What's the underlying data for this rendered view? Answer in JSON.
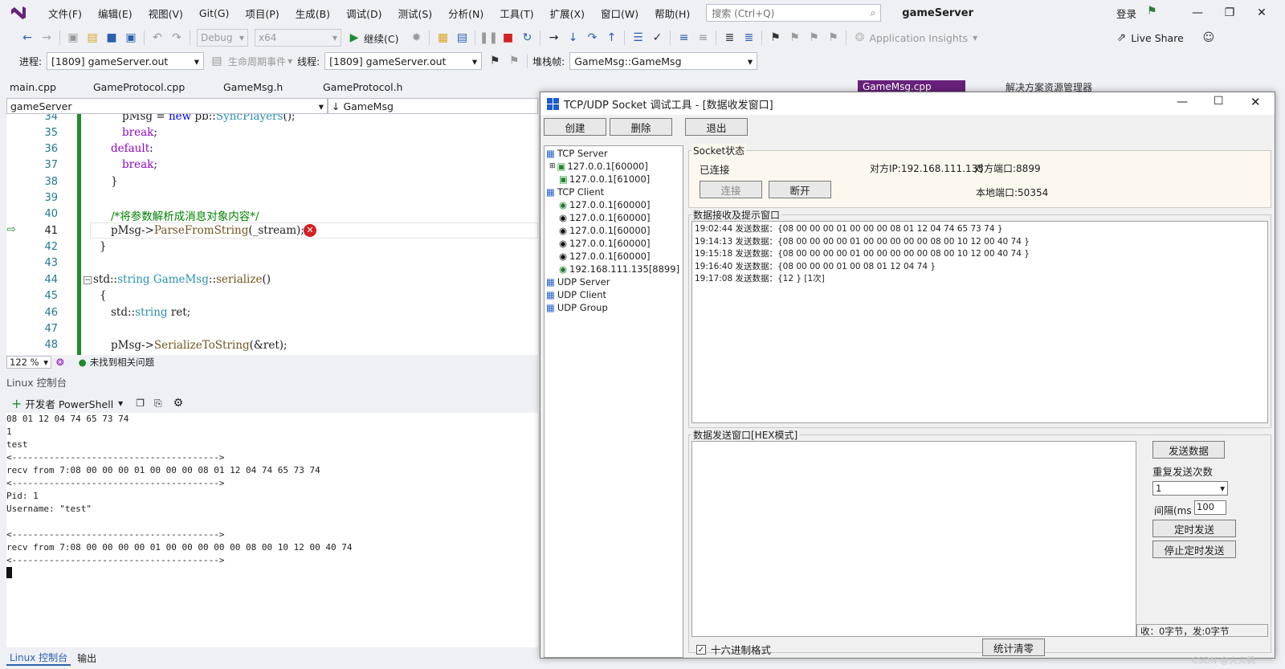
{
  "menus": [
    "文件(F)",
    "编辑(E)",
    "视图(V)",
    "Git(G)",
    "项目(P)",
    "生成(B)",
    "调试(D)",
    "测试(S)",
    "分析(N)",
    "工具(T)",
    "扩展(X)",
    "窗口(W)",
    "帮助(H)"
  ],
  "search_placeholder": "搜索 (Ctrl+Q)",
  "project_name": "gameServer",
  "login": "登录",
  "toolbar": {
    "config": "Debug",
    "platform": "x64",
    "continue": "继续(C)",
    "insights": "Application Insights",
    "live_share": "Live Share"
  },
  "debugbar": {
    "process_label": "进程:",
    "process": "[1809] gameServer.out",
    "lifecycle": "生命周期事件",
    "thread_label": "线程:",
    "thread": "[1809] gameServer.out",
    "stack_label": "堆栈帧:",
    "stack": "GameMsg::GameMsg"
  },
  "tabs": [
    "main.cpp",
    "GameProtocol.cpp",
    "GameMsg.h",
    "GameProtocol.h"
  ],
  "right_tabs": [
    "GameMsg.cpp",
    "解决方案资源管理器"
  ],
  "nav": {
    "scope": "gameServer",
    "member": "GameMsg"
  },
  "code": {
    "l34_num": "34",
    "l35_num": "35",
    "l36_num": "36",
    "l37_num": "37",
    "l38_num": "38",
    "l39_num": "39",
    "l40_num": "40",
    "l41_num": "41",
    "l42_num": "42",
    "l43_num": "43",
    "l44_num": "44",
    "l45_num": "45",
    "l46_num": "46",
    "l47_num": "47",
    "l48_num": "48",
    "l34a": "pMsg = ",
    "l34b": "new",
    "l34c": " pb::",
    "l34d": "SyncPlayers",
    "l34e": "();",
    "l35": "break",
    "l35b": ";",
    "l36": "default",
    "l36b": ":",
    "l37": "break",
    "l37b": ";",
    "l38": "}",
    "l40": "/*将参数解析成消息对象内容*/",
    "l41a": "pMsg->",
    "l41b": "ParseFromString",
    "l41c": "(_stream);",
    "l42": "}",
    "l44a": "std::",
    "l44b": "string",
    "l44c": " ",
    "l44d": "GameMsg",
    "l44e": "::",
    "l44f": "serialize",
    "l44g": "()",
    "l45": "{",
    "l46a": "std::",
    "l46b": "string",
    "l46c": " ret;",
    "l48a": "pMsg->",
    "l48b": "SerializeToString",
    "l48c": "(&ret);"
  },
  "editor_status": {
    "zoom": "122 %",
    "issues": "未找到相关问题"
  },
  "console_title": "Linux 控制台",
  "console_shell": "开发者 PowerShell",
  "console_lines": [
    "08 01 12 04 74 65 73 74",
    "1",
    "test",
    "<--------------------------------------->",
    "recv from 7:08 00 00 00 01 00 00 00 08 01 12 04 74 65 73 74",
    "<--------------------------------------->",
    "Pid: 1",
    "Username: \"test\"",
    "",
    "<--------------------------------------->",
    "recv from 7:08 00 00 00 00 01 00 00 00 00 00 08 00 10 12 00 40 74",
    "<--------------------------------------->"
  ],
  "bottom_tabs": [
    "Linux 控制台",
    "输出"
  ],
  "dialog": {
    "title": "TCP/UDP Socket 调试工具 - [数据收发窗口]",
    "btn_create": "创建",
    "btn_delete": "删除",
    "btn_exit": "退出",
    "tree": {
      "tcp_server": "TCP Server",
      "server_items": [
        "127.0.0.1[60000]",
        "127.0.0.1[61000]"
      ],
      "tcp_client": "TCP Client",
      "client_items": [
        "127.0.0.1[60000]",
        "127.0.0.1[60000]",
        "127.0.0.1[60000]",
        "127.0.0.1[60000]",
        "127.0.0.1[60000]",
        "192.168.111.135[8899]"
      ],
      "udp_server": "UDP Server",
      "udp_client": "UDP Client",
      "udp_group": "UDP Group"
    },
    "socket_group": "Socket状态",
    "status": "已连接",
    "peer_ip": "对方IP:192.168.111.135",
    "peer_port": "对方端口:8899",
    "local_port": "本地端口:50354",
    "btn_connect": "连接",
    "btn_disconnect": "断开",
    "recv_group": "数据接收及提示窗口",
    "recv_lines": [
      "19:02:44 发送数据：{08 00 00 00 01 00 00 00 08 01 12 04 74 65 73 74 }",
      "19:14:13 发送数据：{08 00 00 00 00 01 00 00 00 00 00 08 00 10 12 00 40 74 }",
      "19:15:18 发送数据：{08 00 00 00 00 01 00 00 00 00 00 08 00 10 12 00 40 74 }",
      "19:16:40 发送数据：{08 00 00 00 01 00 08 01 12 04 74 }",
      "19:17:08 发送数据：{12 } [1次]"
    ],
    "send_group": "数据发送窗口[HEX模式]",
    "btn_send": "发送数据",
    "repeat_label": "重复发送次数",
    "repeat_value": "1",
    "interval_label": "间隔(ms",
    "interval_value": "100",
    "btn_timer": "定时发送",
    "btn_stop_timer": "停止定时发送",
    "counter": "收：0字节，发:0字节",
    "hex_label": "十六进制格式",
    "btn_clear": "统计清零"
  },
  "watermark": "CSDN @大大枫"
}
